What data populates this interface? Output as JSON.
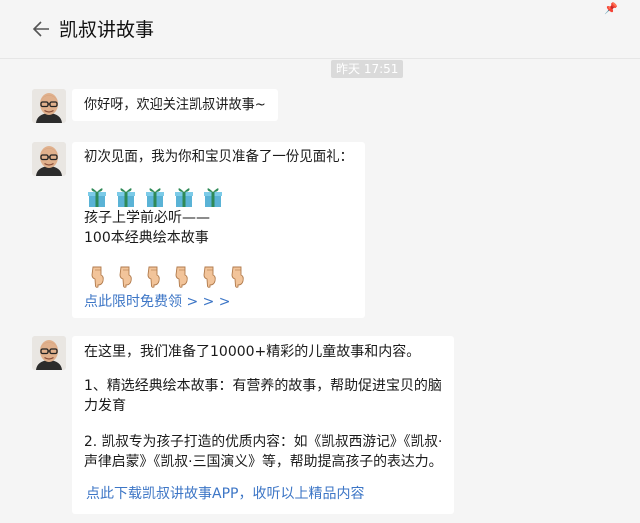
{
  "header": {
    "title": "凯叔讲故事",
    "back_icon": "arrow-left-icon",
    "pin_icon": "pin-icon"
  },
  "timestamp": "昨天 17:51",
  "messages": [
    {
      "text": "你好呀，欢迎关注凯叔讲故事~"
    },
    {
      "line1": "初次见面，我为你和宝贝准备了一份见面礼：",
      "gift_icons": [
        "gift-icon",
        "gift-icon",
        "gift-icon",
        "gift-icon",
        "gift-icon"
      ],
      "line2": "孩子上学前必听——",
      "line3": "100本经典绘本故事",
      "point_icons": [
        "pointing-down-icon",
        "pointing-down-icon",
        "pointing-down-icon",
        "pointing-down-icon",
        "pointing-down-icon",
        "pointing-down-icon"
      ],
      "link": "点此限时免费领 > > >"
    },
    {
      "p1": "在这里，我们准备了10000+精彩的儿童故事和内容。",
      "p2a": "1、精选经典绘本故事：有营养的故事，帮助促进宝贝的脑",
      "p2b": "力发育",
      "p3a": "2. 凯叔专为孩子打造的优质内容：如《凯叔西游记》《凯叔·",
      "p3b": "声律启蒙》《凯叔·三国演义》等，帮助提高孩子的表达力。",
      "link": "点此下载凯叔讲故事APP，收听以上精品内容"
    }
  ],
  "colors": {
    "link": "#3d76c6",
    "background": "#f5f5f5",
    "bubble": "#ffffff"
  }
}
